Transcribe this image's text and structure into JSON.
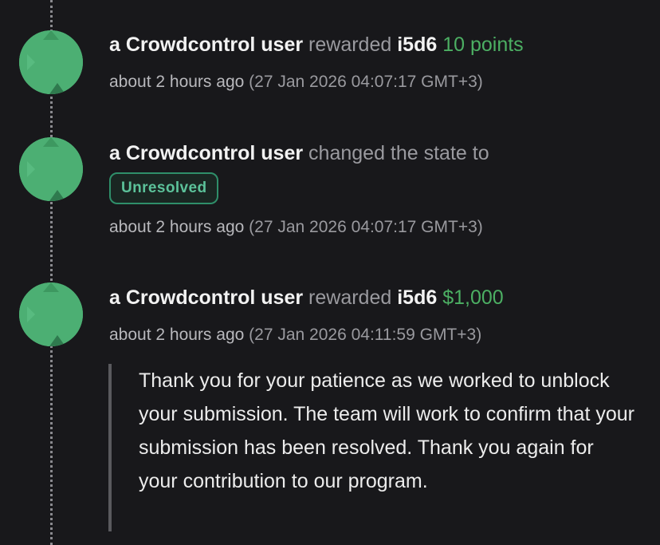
{
  "events": [
    {
      "actor": "a Crowdcontrol user",
      "action": "rewarded",
      "target": "i5d6",
      "amount": "10 points",
      "time_relative": "about 2 hours ago",
      "time_absolute": "(27 Jan 2026 04:07:17 GMT+3)"
    },
    {
      "actor": "a Crowdcontrol user",
      "action": "changed the state to",
      "state": "Unresolved",
      "time_relative": "about 2 hours ago",
      "time_absolute": "(27 Jan 2026 04:07:17 GMT+3)"
    },
    {
      "actor": "a Crowdcontrol user",
      "action": "rewarded",
      "target": "i5d6",
      "amount": "$1,000",
      "time_relative": "about 2 hours ago",
      "time_absolute": "(27 Jan 2026 04:11:59 GMT+3)",
      "comment": "Thank you for your patience as we worked to unblock your submission. The team will work to confirm that your submission has been resolved. Thank you again for your contribution to our program."
    }
  ],
  "colors": {
    "background": "#18181b",
    "avatar": "#4caf73",
    "amount": "#4caf63",
    "badge": "#5cc29a"
  },
  "icons": [
    "avatar-geometric-icon"
  ]
}
